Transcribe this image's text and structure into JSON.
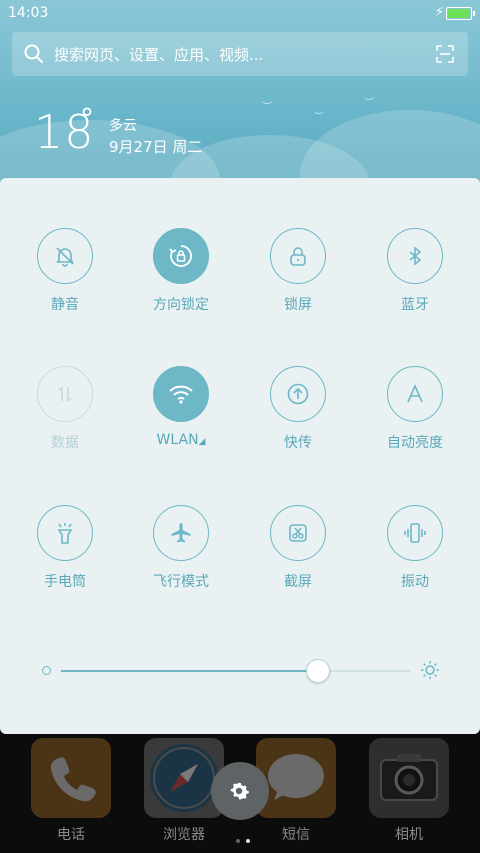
{
  "status": {
    "time": "14:03"
  },
  "search": {
    "placeholder": "搜索网页、设置、应用、视频..."
  },
  "weather": {
    "temperature": "18",
    "degree": "°",
    "condition": "多云",
    "date": "9月27日 周二"
  },
  "toggles": [
    {
      "label": "静音",
      "icon": "bell-off-icon",
      "state": "off"
    },
    {
      "label": "方向锁定",
      "icon": "rotation-lock-icon",
      "state": "on"
    },
    {
      "label": "锁屏",
      "icon": "lock-icon",
      "state": "off"
    },
    {
      "label": "蓝牙",
      "icon": "bluetooth-icon",
      "state": "off"
    },
    {
      "label": "数据",
      "icon": "mobile-data-icon",
      "state": "disabled"
    },
    {
      "label": "WLAN",
      "icon": "wifi-icon",
      "state": "on"
    },
    {
      "label": "快传",
      "icon": "transfer-icon",
      "state": "off"
    },
    {
      "label": "自动亮度",
      "icon": "auto-brightness-icon",
      "state": "off"
    },
    {
      "label": "手电筒",
      "icon": "flashlight-icon",
      "state": "off"
    },
    {
      "label": "飞行模式",
      "icon": "airplane-icon",
      "state": "off"
    },
    {
      "label": "截屏",
      "icon": "screenshot-icon",
      "state": "off"
    },
    {
      "label": "振动",
      "icon": "vibrate-icon",
      "state": "off"
    }
  ],
  "brightness": {
    "level": 0.73
  },
  "dock": [
    {
      "label": "电话",
      "icon": "phone-icon"
    },
    {
      "label": "浏览器",
      "icon": "browser-icon"
    },
    {
      "label": "短信",
      "icon": "messages-icon"
    },
    {
      "label": "相机",
      "icon": "camera-icon"
    }
  ],
  "colors": {
    "accent": "#6db7c7",
    "header": "#6ab6ca",
    "panel": "#e9f1f3"
  }
}
